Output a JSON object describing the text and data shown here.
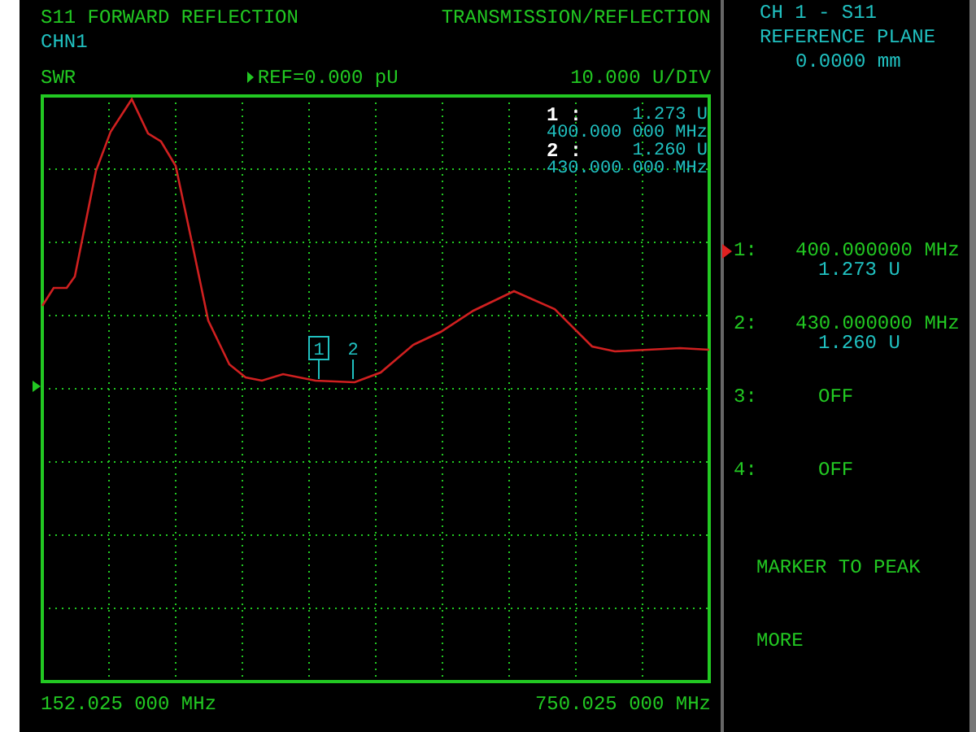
{
  "header": {
    "title": "S11 FORWARD REFLECTION",
    "mode": "TRANSMISSION/REFLECTION",
    "channel": "CHN1",
    "format": "SWR",
    "reference": "REF=0.000 pU",
    "scale": "10.000 U/DIV"
  },
  "readout": [
    {
      "label": "1 :",
      "value": "1.273 U",
      "frequency": "400.000 000 MHz"
    },
    {
      "label": "2 :",
      "value": "1.260 U",
      "frequency": "430.000 000 MHz"
    }
  ],
  "trace_markers": [
    {
      "label": "1",
      "selected": true
    },
    {
      "label": "2",
      "selected": false
    }
  ],
  "axis": {
    "start": "152.025 000 MHz",
    "stop": "750.025 000 MHz"
  },
  "panel": {
    "title": "CH 1 - S11",
    "subtitle": "REFERENCE PLANE",
    "value": "0.0000 mm"
  },
  "softkeys": [
    {
      "kind": "marker",
      "number": "1:",
      "frequency": "400.000000 MHz",
      "value": "1.273 U",
      "selected": true
    },
    {
      "kind": "marker",
      "number": "2:",
      "frequency": "430.000000 MHz",
      "value": "1.260 U",
      "selected": false
    },
    {
      "kind": "off",
      "number": "3:",
      "state": "OFF"
    },
    {
      "kind": "off",
      "number": "4:",
      "state": "OFF"
    },
    {
      "kind": "action",
      "label": "MARKER TO PEAK"
    },
    {
      "kind": "action",
      "label": "MORE"
    }
  ]
}
